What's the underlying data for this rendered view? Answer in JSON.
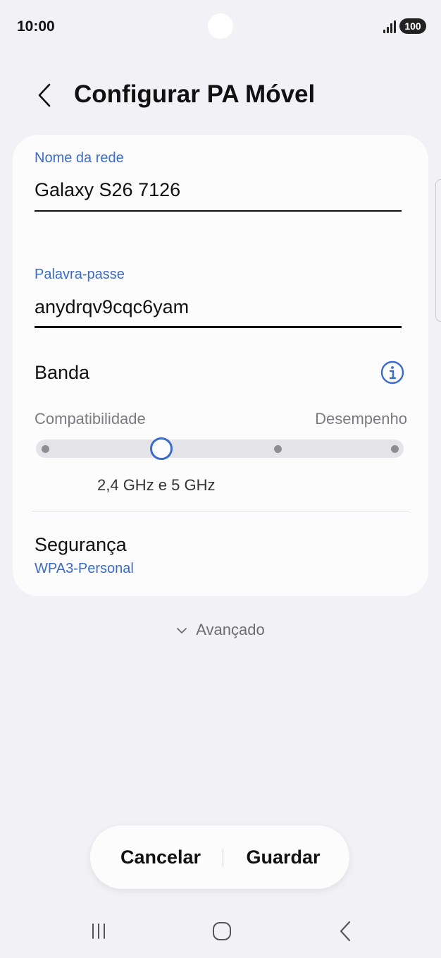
{
  "status_bar": {
    "time": "10:00",
    "battery": "100",
    "icons": [
      "camera-cutout",
      "signal-icon",
      "battery-icon"
    ]
  },
  "header": {
    "title": "Configurar PA Móvel",
    "back_icon": "chevron-left-icon"
  },
  "form": {
    "network_name": {
      "label": "Nome da rede",
      "value": "Galaxy S26 7126"
    },
    "password": {
      "label": "Palavra-passe",
      "value": "anydrqv9cqc6yam"
    },
    "band": {
      "label": "Banda",
      "info_icon": "info-icon",
      "scale_left": "Compatibilidade",
      "scale_right": "Desempenho",
      "steps": 4,
      "selected_step": 1,
      "selected_value": "2,4 GHz e 5 GHz"
    },
    "security": {
      "label": "Segurança",
      "value": "WPA3-Personal"
    }
  },
  "advanced": {
    "label": "Avançado",
    "icon": "chevron-down-icon"
  },
  "actions": {
    "cancel": "Cancelar",
    "save": "Guardar"
  },
  "nav": {
    "icons": [
      "recents-icon",
      "home-icon",
      "back-icon"
    ]
  },
  "colors": {
    "accent": "#3a6cc8",
    "background": "#f2f2f6",
    "card": "#fcfcfd"
  }
}
